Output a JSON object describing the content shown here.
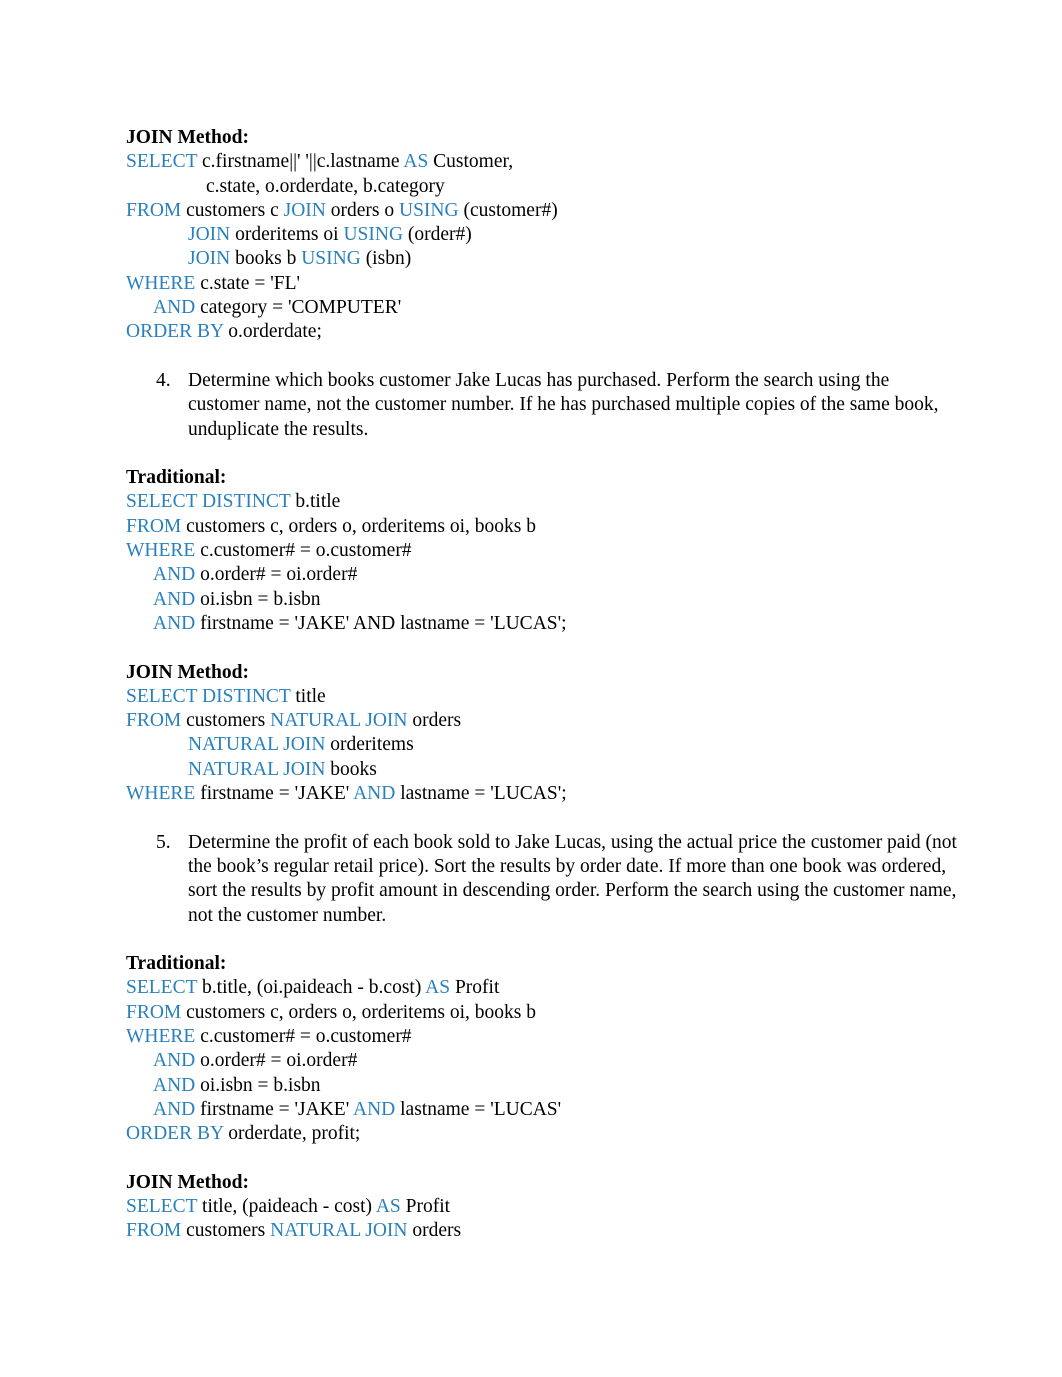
{
  "document": {
    "labels": {
      "join_method": "JOIN Method:",
      "traditional": "Traditional:"
    },
    "colors": {
      "keyword_blue": "#2980bd",
      "body_text": "#000000",
      "page_background": "#ffffff"
    },
    "blocks": [
      {
        "id": "join-method-3",
        "kind": "sql",
        "heading": "JOIN Method:",
        "lines": [
          {
            "indent": "none",
            "tokens": [
              {
                "t": "SELECT",
                "kw": true
              },
              {
                "t": " c.firstname||' '||c.lastname ",
                "kw": false
              },
              {
                "t": "AS",
                "kw": true
              },
              {
                "t": " Customer,",
                "kw": false
              }
            ]
          },
          {
            "indent": "select",
            "tokens": [
              {
                "t": "c.state, o.orderdate, b.category",
                "kw": false
              }
            ]
          },
          {
            "indent": "none",
            "tokens": [
              {
                "t": "FROM",
                "kw": true
              },
              {
                "t": " customers c ",
                "kw": false
              },
              {
                "t": "JOIN",
                "kw": true
              },
              {
                "t": " orders o ",
                "kw": false
              },
              {
                "t": "USING",
                "kw": true
              },
              {
                "t": " (customer#)",
                "kw": false
              }
            ]
          },
          {
            "indent": "join",
            "tokens": [
              {
                "t": "JOIN",
                "kw": true
              },
              {
                "t": " orderitems oi ",
                "kw": false
              },
              {
                "t": "USING",
                "kw": true
              },
              {
                "t": " (order#)",
                "kw": false
              }
            ]
          },
          {
            "indent": "join",
            "tokens": [
              {
                "t": "JOIN",
                "kw": true
              },
              {
                "t": " books b ",
                "kw": false
              },
              {
                "t": "USING",
                "kw": true
              },
              {
                "t": " (isbn)",
                "kw": false
              }
            ]
          },
          {
            "indent": "none",
            "tokens": [
              {
                "t": "WHERE",
                "kw": true
              },
              {
                "t": " c.state = 'FL'",
                "kw": false
              }
            ]
          },
          {
            "indent": "and",
            "tokens": [
              {
                "t": "AND",
                "kw": true
              },
              {
                "t": " category = 'COMPUTER'",
                "kw": false
              }
            ]
          },
          {
            "indent": "none",
            "tokens": [
              {
                "t": "ORDER BY",
                "kw": true
              },
              {
                "t": " o.orderdate;",
                "kw": false
              }
            ]
          }
        ]
      },
      {
        "id": "question-4",
        "kind": "question",
        "number": "4.",
        "text": "Determine which books customer Jake Lucas has purchased. Perform the search using the customer name, not the customer number. If he has purchased multiple copies of the same book, unduplicate the results."
      },
      {
        "id": "traditional-4",
        "kind": "sql",
        "heading": "Traditional:",
        "lines": [
          {
            "indent": "none",
            "tokens": [
              {
                "t": "SELECT DISTINCT",
                "kw": true
              },
              {
                "t": " b.title",
                "kw": false
              }
            ]
          },
          {
            "indent": "none",
            "tokens": [
              {
                "t": "FROM",
                "kw": true
              },
              {
                "t": " customers c, orders o, orderitems oi, books b",
                "kw": false
              }
            ]
          },
          {
            "indent": "none",
            "tokens": [
              {
                "t": "WHERE",
                "kw": true
              },
              {
                "t": " c.customer# = o.customer#",
                "kw": false
              }
            ]
          },
          {
            "indent": "and",
            "tokens": [
              {
                "t": "AND",
                "kw": true
              },
              {
                "t": " o.order# = oi.order#",
                "kw": false
              }
            ]
          },
          {
            "indent": "and",
            "tokens": [
              {
                "t": "AND",
                "kw": true
              },
              {
                "t": " oi.isbn = b.isbn",
                "kw": false
              }
            ]
          },
          {
            "indent": "and",
            "tokens": [
              {
                "t": "AND",
                "kw": true
              },
              {
                "t": " firstname = 'JAKE' AND lastname = 'LUCAS';",
                "kw": false
              }
            ]
          }
        ]
      },
      {
        "id": "join-method-4",
        "kind": "sql",
        "heading": "JOIN Method:",
        "lines": [
          {
            "indent": "none",
            "tokens": [
              {
                "t": "SELECT DISTINCT",
                "kw": true
              },
              {
                "t": " title",
                "kw": false
              }
            ]
          },
          {
            "indent": "none",
            "tokens": [
              {
                "t": "FROM",
                "kw": true
              },
              {
                "t": " customers ",
                "kw": false
              },
              {
                "t": "NATURAL JOIN",
                "kw": true
              },
              {
                "t": " orders",
                "kw": false
              }
            ]
          },
          {
            "indent": "join",
            "tokens": [
              {
                "t": "NATURAL JOIN",
                "kw": true
              },
              {
                "t": " orderitems",
                "kw": false
              }
            ]
          },
          {
            "indent": "join",
            "tokens": [
              {
                "t": "NATURAL JOIN",
                "kw": true
              },
              {
                "t": " books",
                "kw": false
              }
            ]
          },
          {
            "indent": "none",
            "tokens": [
              {
                "t": "WHERE",
                "kw": true
              },
              {
                "t": " firstname = 'JAKE' ",
                "kw": false
              },
              {
                "t": "AND",
                "kw": true
              },
              {
                "t": " lastname = 'LUCAS';",
                "kw": false
              }
            ]
          }
        ]
      },
      {
        "id": "question-5",
        "kind": "question",
        "number": "5.",
        "text": "Determine the profit of each book sold to Jake Lucas, using the actual price the customer paid (not the book’s regular retail price). Sort the results by order date. If more than one book was ordered, sort the results by profit amount in descending order. Perform the search using the customer name, not the customer number."
      },
      {
        "id": "traditional-5",
        "kind": "sql",
        "heading": "Traditional:",
        "lines": [
          {
            "indent": "none",
            "tokens": [
              {
                "t": "SELECT",
                "kw": true
              },
              {
                "t": " b.title, (oi.paideach - b.cost) ",
                "kw": false
              },
              {
                "t": "AS",
                "kw": true
              },
              {
                "t": " Profit",
                "kw": false
              }
            ]
          },
          {
            "indent": "none",
            "tokens": [
              {
                "t": "FROM",
                "kw": true
              },
              {
                "t": " customers c, orders o, orderitems oi, books b",
                "kw": false
              }
            ]
          },
          {
            "indent": "none",
            "tokens": [
              {
                "t": "WHERE",
                "kw": true
              },
              {
                "t": " c.customer# = o.customer#",
                "kw": false
              }
            ]
          },
          {
            "indent": "and",
            "tokens": [
              {
                "t": "AND",
                "kw": true
              },
              {
                "t": " o.order# = oi.order#",
                "kw": false
              }
            ]
          },
          {
            "indent": "and",
            "tokens": [
              {
                "t": "AND",
                "kw": true
              },
              {
                "t": " oi.isbn = b.isbn",
                "kw": false
              }
            ]
          },
          {
            "indent": "and",
            "tokens": [
              {
                "t": "AND",
                "kw": true
              },
              {
                "t": " firstname = 'JAKE' ",
                "kw": false
              },
              {
                "t": "AND",
                "kw": true
              },
              {
                "t": " lastname = 'LUCAS'",
                "kw": false
              }
            ]
          },
          {
            "indent": "none",
            "tokens": [
              {
                "t": "ORDER BY",
                "kw": true
              },
              {
                "t": " orderdate, profit;",
                "kw": false
              }
            ]
          }
        ]
      },
      {
        "id": "join-method-5",
        "kind": "sql",
        "heading": "JOIN Method:",
        "lines": [
          {
            "indent": "none",
            "tokens": [
              {
                "t": "SELECT",
                "kw": true
              },
              {
                "t": " title, (paideach - cost) ",
                "kw": false
              },
              {
                "t": "AS",
                "kw": true
              },
              {
                "t": " Profit",
                "kw": false
              }
            ]
          },
          {
            "indent": "none",
            "tokens": [
              {
                "t": "FROM",
                "kw": true
              },
              {
                "t": " customers ",
                "kw": false
              },
              {
                "t": "NATURAL JOIN",
                "kw": true
              },
              {
                "t": " orders",
                "kw": false
              }
            ]
          }
        ]
      }
    ]
  }
}
